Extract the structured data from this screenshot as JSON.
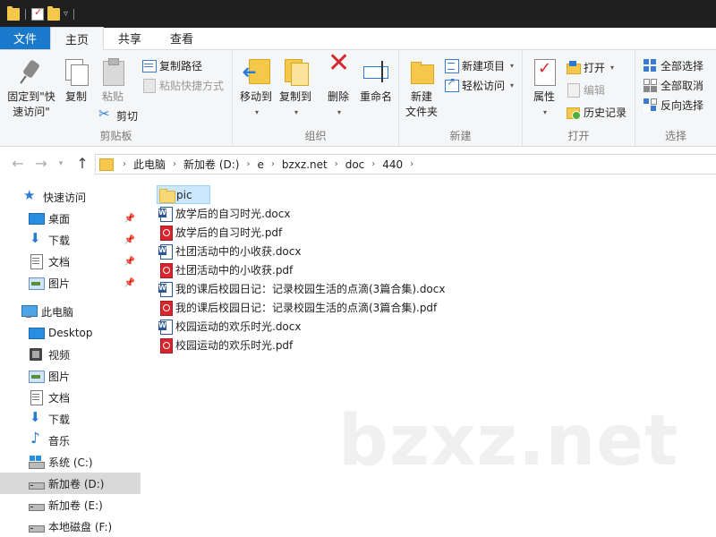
{
  "tabs": {
    "file": "文件",
    "home": "主页",
    "share": "共享",
    "view": "查看"
  },
  "ribbon": {
    "clipboard": {
      "label": "剪贴板",
      "pin_line1": "固定到\"快",
      "pin_line2": "速访问\"",
      "copy": "复制",
      "paste": "粘贴",
      "copy_path": "复制路径",
      "paste_shortcut": "粘贴快捷方式",
      "cut": "剪切"
    },
    "organize": {
      "label": "组织",
      "move_to": "移动到",
      "copy_to": "复制到",
      "delete": "删除",
      "rename": "重命名"
    },
    "new": {
      "label": "新建",
      "new_folder_line1": "新建",
      "new_folder_line2": "文件夹",
      "new_item": "新建项目",
      "easy_access": "轻松访问"
    },
    "open": {
      "label": "打开",
      "properties": "属性",
      "open": "打开",
      "edit": "编辑",
      "history": "历史记录"
    },
    "select": {
      "label": "选择",
      "select_all": "全部选择",
      "select_none": "全部取消",
      "invert": "反向选择"
    }
  },
  "address": {
    "crumbs": [
      "此电脑",
      "新加卷 (D:)",
      "e",
      "bzxz.net",
      "doc",
      "440"
    ]
  },
  "nav": {
    "quick_access": "快速访问",
    "qa_items": [
      "桌面",
      "下载",
      "文档",
      "图片"
    ],
    "this_pc": "此电脑",
    "pc_items": [
      "Desktop",
      "视频",
      "图片",
      "文档",
      "下载",
      "音乐"
    ],
    "drives": [
      "系统 (C:)",
      "新加卷 (D:)",
      "新加卷 (E:)",
      "本地磁盘 (F:)"
    ]
  },
  "files": [
    {
      "name": "pic",
      "type": "folder"
    },
    {
      "name": "放学后的自习时光.docx",
      "type": "word"
    },
    {
      "name": "放学后的自习时光.pdf",
      "type": "pdf"
    },
    {
      "name": "社团活动中的小收获.docx",
      "type": "word"
    },
    {
      "name": "社团活动中的小收获.pdf",
      "type": "pdf"
    },
    {
      "name": "我的课后校园日记：记录校园生活的点滴(3篇合集).docx",
      "type": "word"
    },
    {
      "name": "我的课后校园日记：记录校园生活的点滴(3篇合集).pdf",
      "type": "pdf"
    },
    {
      "name": "校园运动的欢乐时光.docx",
      "type": "word"
    },
    {
      "name": "校园运动的欢乐时光.pdf",
      "type": "pdf"
    }
  ],
  "watermark": "bzxz.net"
}
